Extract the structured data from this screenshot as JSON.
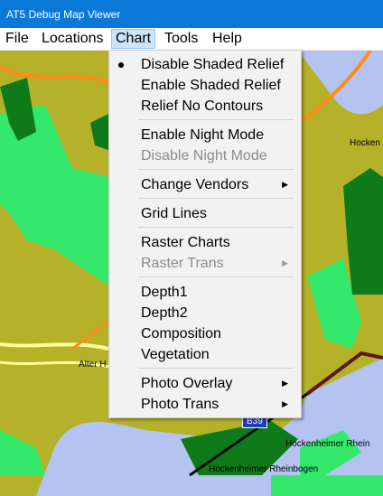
{
  "window": {
    "title": "AT5 Debug Map Viewer"
  },
  "menubar": {
    "items": [
      {
        "label": "File"
      },
      {
        "label": "Locations"
      },
      {
        "label": "Chart"
      },
      {
        "label": "Tools"
      },
      {
        "label": "Help"
      }
    ]
  },
  "chart_menu": {
    "items": [
      {
        "label": "Disable Shaded Relief",
        "enabled": true,
        "checked": true
      },
      {
        "label": "Enable Shaded Relief",
        "enabled": true
      },
      {
        "label": "Relief No Contours",
        "enabled": true
      },
      {
        "label": "Enable Night Mode",
        "enabled": true
      },
      {
        "label": "Disable Night Mode",
        "enabled": false
      },
      {
        "label": "Change Vendors",
        "enabled": true,
        "submenu": true
      },
      {
        "label": "Grid Lines",
        "enabled": true
      },
      {
        "label": "Raster Charts",
        "enabled": true
      },
      {
        "label": "Raster Trans",
        "enabled": false,
        "submenu": true
      },
      {
        "label": "Depth1",
        "enabled": true
      },
      {
        "label": "Depth2",
        "enabled": true
      },
      {
        "label": "Composition",
        "enabled": true
      },
      {
        "label": "Vegetation",
        "enabled": true
      },
      {
        "label": "Photo Overlay",
        "enabled": true,
        "submenu": true
      },
      {
        "label": "Photo Trans",
        "enabled": true,
        "submenu": true
      }
    ]
  },
  "map": {
    "labels": {
      "hocken_top": "Hocken",
      "alter": "Alter H",
      "hockenheimer_rhein": "Hockenheimer Rhein",
      "hockenheimer_rheinbogen": "Hockenheimer Rheinbogen"
    },
    "road_sign": "B39"
  },
  "colors": {
    "titlebar": "#0a78d7",
    "land": "#b5b22a",
    "water": "#b4c3f0",
    "forest": "#0f7a1a",
    "meadow": "#33e86a",
    "road_orange": "#ff8c1a",
    "road_yellow": "#ffff99",
    "road_dark": "#5a1a1a"
  }
}
